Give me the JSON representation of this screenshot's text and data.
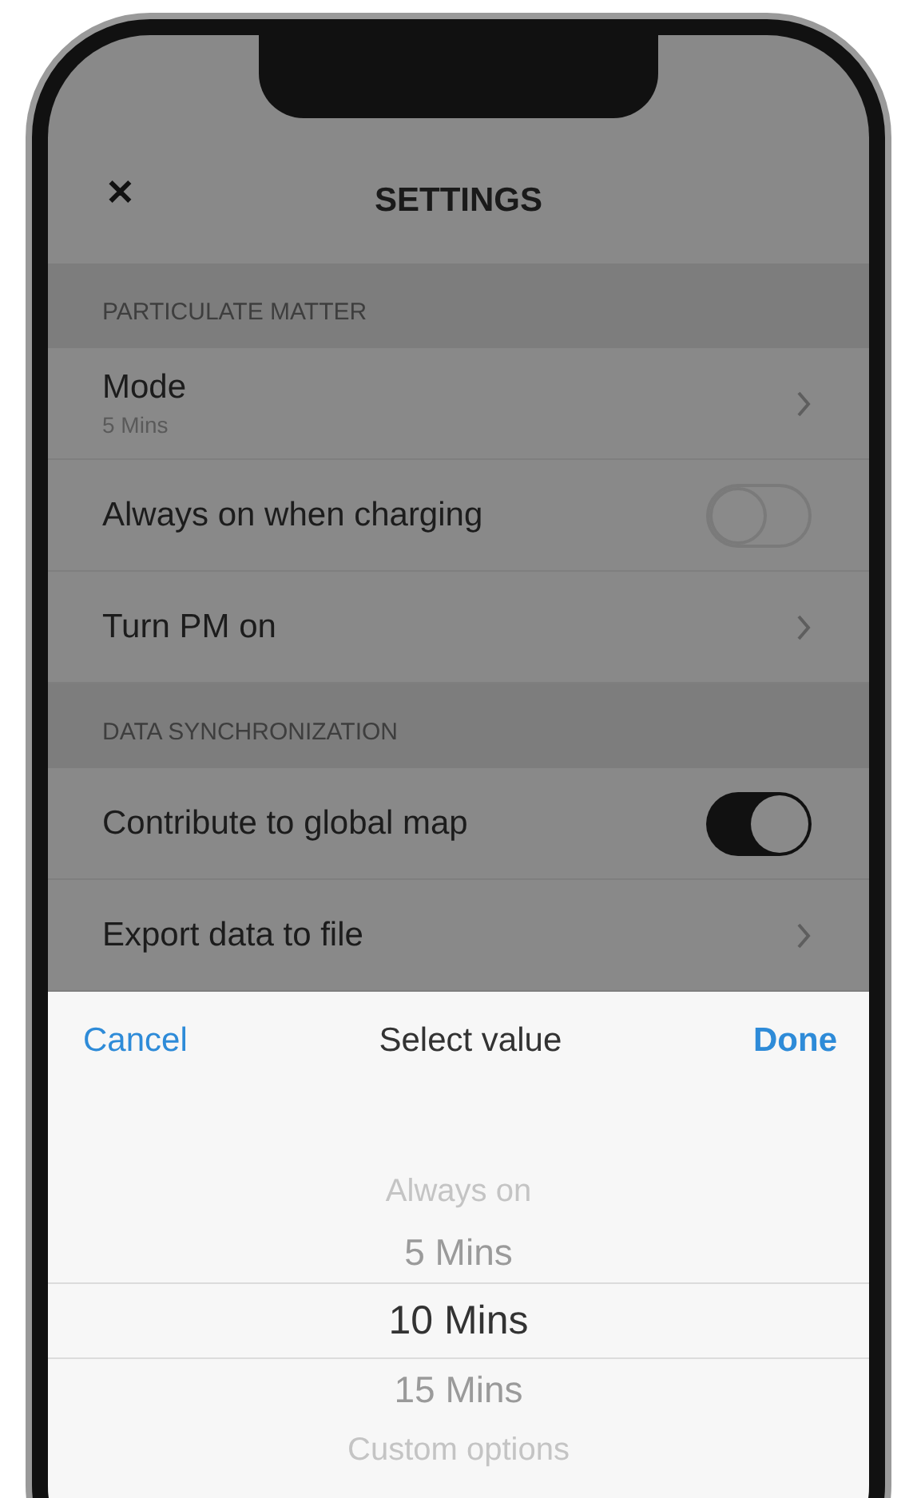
{
  "header": {
    "close": "✕",
    "title": "SETTINGS"
  },
  "sections": [
    {
      "title": "PARTICULATE MATTER",
      "items": [
        {
          "kind": "detail",
          "label": "Mode",
          "value": "5 Mins"
        },
        {
          "kind": "toggle",
          "label": "Always on when charging",
          "on": false
        },
        {
          "kind": "detail",
          "label": "Turn PM on"
        }
      ]
    },
    {
      "title": "DATA SYNCHRONIZATION",
      "items": [
        {
          "kind": "toggle",
          "label": "Contribute to global map",
          "on": true
        },
        {
          "kind": "detail",
          "label": "Export data to file"
        }
      ]
    }
  ],
  "sheet": {
    "cancel": "Cancel",
    "title": "Select value",
    "done": "Done",
    "options": [
      {
        "label": "Always on",
        "selected": false
      },
      {
        "label": "5 Mins",
        "selected": false
      },
      {
        "label": "10 Mins",
        "selected": true
      },
      {
        "label": "15 Mins",
        "selected": false
      },
      {
        "label": "Custom options",
        "selected": false
      }
    ]
  }
}
